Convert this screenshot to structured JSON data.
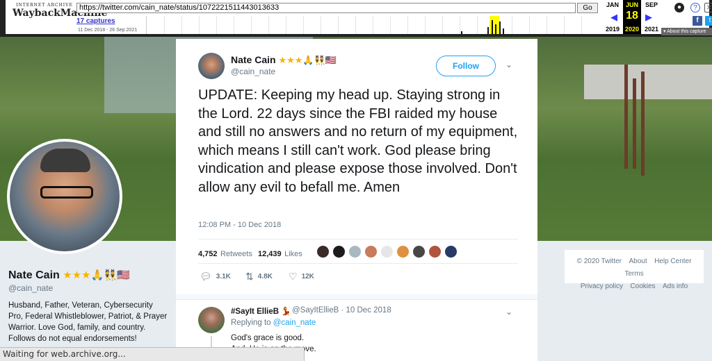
{
  "wayback": {
    "logo_top": "INTERNET ARCHIVE",
    "logo_main": "WaybackMachine",
    "url": "https://twitter.com/cain_nate/status/1072221511443013633",
    "go_label": "Go",
    "captures": "17 captures",
    "range": "11 Dec 2018 - 26 Sep 2021",
    "months": {
      "prev": "JAN",
      "cur": "JUN",
      "next": "SEP"
    },
    "day": "18",
    "years": {
      "prev": "2019",
      "cur": "2020",
      "next": "2021"
    },
    "about": "About this capture",
    "spark_values": [
      0,
      0,
      0,
      0,
      0,
      0,
      0,
      0,
      0,
      0,
      0,
      0,
      0,
      0,
      0,
      0,
      0,
      0,
      0,
      0,
      0,
      0,
      0,
      0,
      0,
      0,
      0,
      0,
      0,
      0,
      0,
      0,
      0,
      0,
      0,
      0,
      0,
      0,
      0,
      0,
      0,
      0,
      0,
      0,
      0,
      0,
      0,
      0,
      0,
      0,
      0,
      0,
      0,
      0,
      0,
      0,
      0,
      0,
      0,
      0,
      0,
      0,
      0,
      0,
      0,
      0,
      0,
      0,
      0,
      0,
      0,
      0,
      0,
      0,
      0,
      0,
      0,
      0,
      0,
      0,
      0,
      0,
      0,
      0,
      0,
      0,
      0,
      0,
      0,
      0,
      0,
      0,
      0,
      0,
      0,
      0,
      0,
      0,
      0,
      0,
      0,
      0,
      0,
      0,
      0,
      0,
      0,
      0,
      0,
      0,
      0,
      0,
      0,
      0,
      0,
      0,
      0,
      0,
      0,
      0,
      0,
      0,
      0,
      0,
      0,
      0,
      0,
      0,
      0,
      0,
      0,
      0,
      0,
      0,
      0,
      0,
      0,
      0,
      0,
      0,
      0,
      0,
      0,
      0,
      0,
      0,
      0,
      0,
      0,
      0,
      0,
      0,
      0,
      0,
      0,
      0,
      0,
      0,
      0,
      0,
      0,
      0,
      0,
      0,
      0,
      0,
      0,
      0,
      0,
      0,
      0,
      0,
      0,
      0,
      0,
      0,
      0,
      0,
      0,
      0,
      0,
      0,
      0,
      0,
      0,
      0,
      0,
      0,
      0,
      0,
      0,
      0,
      0,
      0,
      0,
      0,
      0,
      0,
      0,
      0,
      0,
      0,
      0,
      0,
      0,
      0,
      0,
      0,
      0,
      0,
      0,
      0,
      0,
      0,
      0,
      0,
      0,
      0,
      0,
      0,
      0,
      0,
      0,
      0,
      0,
      0,
      0,
      0,
      0,
      0,
      0,
      0,
      0,
      0,
      0,
      0,
      0,
      0,
      0,
      0,
      0,
      0,
      0,
      0,
      0,
      0,
      0,
      0,
      0,
      0,
      0,
      0,
      0,
      0,
      0,
      0,
      0,
      0,
      0,
      0,
      0,
      0,
      0,
      0,
      0,
      0,
      0,
      0,
      0,
      0,
      0,
      0,
      0,
      0,
      0,
      0,
      0,
      0,
      0,
      0,
      0,
      0,
      0,
      0,
      0,
      0,
      0,
      0,
      0,
      0,
      0,
      0,
      0,
      0,
      0,
      0,
      0,
      0,
      0,
      0,
      0,
      0,
      0,
      0,
      0,
      0,
      0,
      0,
      0,
      0,
      0,
      0,
      0,
      0,
      0,
      0,
      0,
      0,
      0,
      0,
      0,
      0,
      0,
      0,
      0,
      0,
      0,
      0,
      0,
      0,
      0,
      0,
      0,
      0,
      0,
      0,
      0,
      0,
      0,
      0,
      0,
      0,
      0,
      0,
      0,
      0,
      0,
      0,
      0,
      0,
      0,
      0,
      0,
      0,
      0,
      0,
      0,
      0,
      0,
      0,
      0,
      0,
      0,
      0,
      0,
      0,
      0,
      0,
      0,
      0,
      0,
      0,
      0,
      0,
      0,
      0,
      0,
      0,
      0,
      0,
      0,
      0,
      0,
      0,
      0,
      0,
      0,
      0,
      0,
      0,
      0,
      0,
      0,
      0,
      0,
      0,
      0,
      0,
      0,
      0,
      0,
      0,
      0,
      0,
      0,
      0,
      0,
      0,
      0,
      0,
      0,
      0,
      0,
      0,
      0,
      0,
      0,
      0,
      0,
      0,
      0,
      0,
      0,
      0,
      0,
      0,
      0,
      0,
      0,
      0,
      0,
      0,
      0,
      0,
      0,
      0,
      0,
      0,
      0,
      0,
      0,
      0,
      0,
      0,
      0,
      0,
      0,
      0,
      0,
      0,
      0,
      0,
      0,
      0,
      0,
      0,
      0,
      0,
      0,
      0,
      0,
      0,
      0,
      0,
      0,
      0,
      0,
      0,
      0,
      0,
      0,
      0,
      0,
      0,
      0,
      0,
      0,
      0,
      0,
      0,
      0,
      0,
      0,
      0,
      0,
      0,
      0,
      0,
      0,
      0,
      0,
      0,
      0,
      0,
      0,
      0,
      0,
      0,
      0,
      0,
      0,
      0,
      0,
      0,
      0,
      0,
      0,
      0,
      0,
      0,
      0,
      0,
      0,
      0,
      0,
      0,
      0,
      0,
      0,
      0,
      0,
      0,
      0,
      0,
      0,
      0,
      0,
      0,
      0,
      0,
      0,
      0,
      0,
      0,
      0,
      0,
      0,
      0,
      0,
      0,
      0,
      0,
      0,
      0,
      0,
      0,
      0,
      0,
      0,
      0,
      0,
      0,
      0,
      0,
      0,
      0,
      0,
      0,
      0,
      0,
      0,
      0,
      0,
      0,
      0,
      0,
      0,
      0,
      0,
      0,
      0,
      0,
      0,
      0,
      0,
      0,
      0,
      0,
      0,
      0,
      0,
      0,
      0,
      0,
      0,
      0,
      0,
      0,
      0,
      0,
      0,
      0,
      0,
      0,
      0,
      0,
      0,
      0,
      0,
      0,
      0,
      0,
      0,
      0,
      0,
      0,
      0,
      0,
      0,
      0,
      0,
      0,
      0,
      0,
      0,
      0,
      0,
      0,
      0,
      0,
      0,
      0,
      0,
      0,
      0,
      0,
      0,
      0,
      0,
      0,
      0,
      0,
      0,
      0,
      0,
      0,
      0,
      0,
      0,
      0,
      0,
      0,
      0,
      0,
      0,
      0,
      0,
      0,
      0,
      0,
      0,
      0,
      0,
      0,
      0,
      0,
      0,
      0,
      0,
      0,
      0,
      0,
      0,
      0,
      0,
      0,
      0,
      0,
      0,
      0,
      0,
      0,
      0,
      0,
      0,
      0,
      0,
      0,
      0,
      0,
      0,
      0,
      0,
      0,
      0,
      0,
      0,
      0,
      0,
      0,
      0,
      0,
      0,
      0,
      0,
      0,
      0,
      0,
      0,
      0,
      0,
      0,
      0,
      0,
      0,
      0,
      0,
      0,
      0,
      0,
      0,
      0,
      0,
      0,
      0,
      0,
      0,
      0,
      0,
      0,
      0,
      0,
      0,
      0,
      0
    ]
  },
  "profile": {
    "name": "Nate Cain",
    "badges": "★★★🙏👯🇺🇸",
    "handle": "@cain_nate",
    "bio": "Husband, Father, Veteran, Cybersecurity Pro, Federal Whistleblower, Patriot, & Prayer Warrior. Love God, family, and country. Follows do not equal endorsements!"
  },
  "tweet": {
    "name": "Nate Cain",
    "badges": "★★★🙏👯🇺🇸",
    "handle": "@cain_nate",
    "follow": "Follow",
    "text": "UPDATE: Keeping my head up. Staying strong in the Lord. 22 days since the FBI raided my house and still no answers and no return of my equipment, which means I still can't work. God please bring vindication and please expose those involved. Don't allow any evil to befall me. Amen",
    "time": "12:08 PM - 10 Dec 2018",
    "retweets_n": "4,752",
    "retweets_l": "Retweets",
    "likes_n": "12,439",
    "likes_l": "Likes",
    "replies": "3.1K",
    "rts": "4.8K",
    "favs": "12K"
  },
  "reply": {
    "name": "#SayIt EllieB 💃",
    "handle": "@SayItEllieB · 10 Dec 2018",
    "replying_prefix": "Replying to ",
    "replying_to": "@cain_nate",
    "line1": "God's grace is good.",
    "line2": "And, He is on the move."
  },
  "footer": {
    "items": [
      "© 2020 Twitter",
      "About",
      "Help Center",
      "Terms",
      "Privacy policy",
      "Cookies",
      "Ads info"
    ]
  },
  "status": "Waiting for web.archive.org..."
}
